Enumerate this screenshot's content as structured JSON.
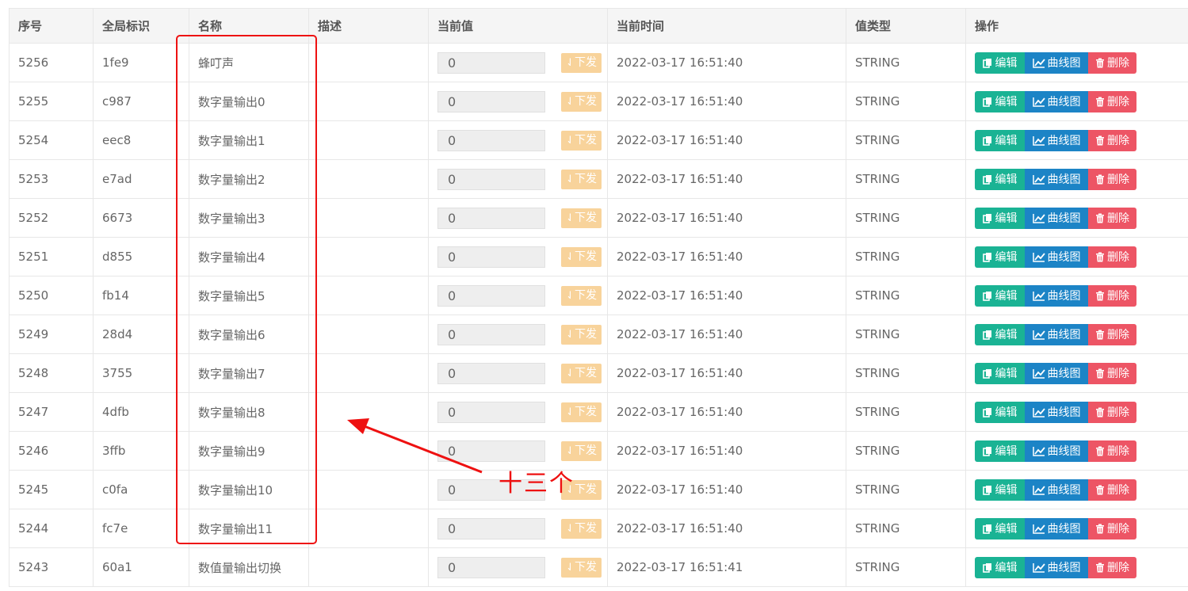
{
  "table": {
    "headers": [
      "序号",
      "全局标识",
      "名称",
      "描述",
      "当前值",
      "当前时间",
      "值类型",
      "操作"
    ],
    "send_label": "下发",
    "actions": {
      "edit": "编辑",
      "chart": "曲线图",
      "delete": "删除"
    },
    "rows": [
      {
        "id": "5256",
        "gid": "1fe9",
        "name": "蜂叮声",
        "desc": "",
        "value": "0",
        "time": "2022-03-17 16:51:40",
        "type": "STRING"
      },
      {
        "id": "5255",
        "gid": "c987",
        "name": "数字量输出0",
        "desc": "",
        "value": "0",
        "time": "2022-03-17 16:51:40",
        "type": "STRING"
      },
      {
        "id": "5254",
        "gid": "eec8",
        "name": "数字量输出1",
        "desc": "",
        "value": "0",
        "time": "2022-03-17 16:51:40",
        "type": "STRING"
      },
      {
        "id": "5253",
        "gid": "e7ad",
        "name": "数字量输出2",
        "desc": "",
        "value": "0",
        "time": "2022-03-17 16:51:40",
        "type": "STRING"
      },
      {
        "id": "5252",
        "gid": "6673",
        "name": "数字量输出3",
        "desc": "",
        "value": "0",
        "time": "2022-03-17 16:51:40",
        "type": "STRING"
      },
      {
        "id": "5251",
        "gid": "d855",
        "name": "数字量输出4",
        "desc": "",
        "value": "0",
        "time": "2022-03-17 16:51:40",
        "type": "STRING"
      },
      {
        "id": "5250",
        "gid": "fb14",
        "name": "数字量输出5",
        "desc": "",
        "value": "0",
        "time": "2022-03-17 16:51:40",
        "type": "STRING"
      },
      {
        "id": "5249",
        "gid": "28d4",
        "name": "数字量输出6",
        "desc": "",
        "value": "0",
        "time": "2022-03-17 16:51:40",
        "type": "STRING"
      },
      {
        "id": "5248",
        "gid": "3755",
        "name": "数字量输出7",
        "desc": "",
        "value": "0",
        "time": "2022-03-17 16:51:40",
        "type": "STRING"
      },
      {
        "id": "5247",
        "gid": "4dfb",
        "name": "数字量输出8",
        "desc": "",
        "value": "0",
        "time": "2022-03-17 16:51:40",
        "type": "STRING"
      },
      {
        "id": "5246",
        "gid": "3ffb",
        "name": "数字量输出9",
        "desc": "",
        "value": "0",
        "time": "2022-03-17 16:51:40",
        "type": "STRING"
      },
      {
        "id": "5245",
        "gid": "c0fa",
        "name": "数字量输出10",
        "desc": "",
        "value": "0",
        "time": "2022-03-17 16:51:40",
        "type": "STRING"
      },
      {
        "id": "5244",
        "gid": "fc7e",
        "name": "数字量输出11",
        "desc": "",
        "value": "0",
        "time": "2022-03-17 16:51:40",
        "type": "STRING"
      },
      {
        "id": "5243",
        "gid": "60a1",
        "name": "数值量输出切换",
        "desc": "",
        "value": "0",
        "time": "2022-03-17 16:51:41",
        "type": "STRING"
      }
    ]
  },
  "annotation": {
    "text": "十三个",
    "color": "#ee1111"
  },
  "colors": {
    "edit": "#1ab394",
    "chart": "#1c84c6",
    "delete": "#ed5565",
    "send": "#f8d39b"
  }
}
